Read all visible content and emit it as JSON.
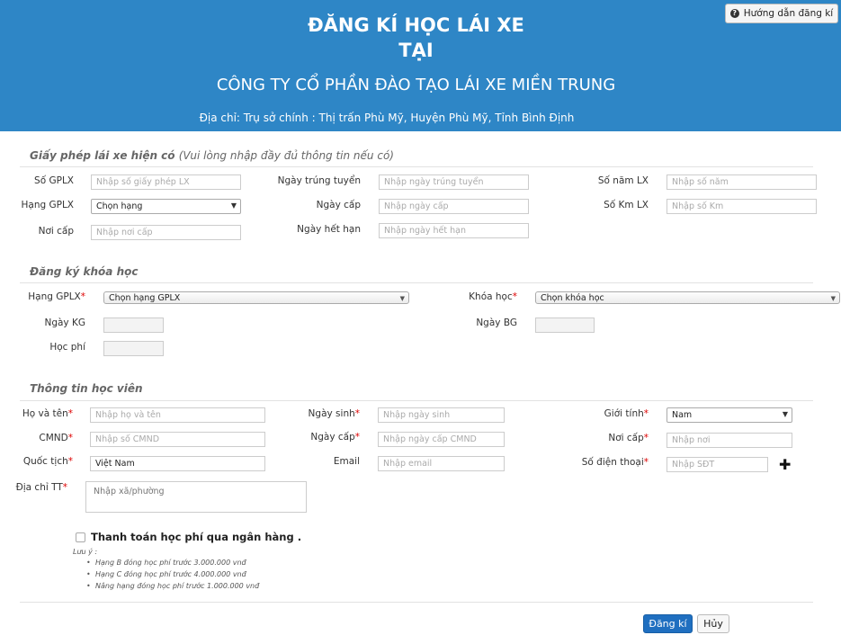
{
  "header": {
    "title_line1": "ĐĂNG KÍ HỌC LÁI XE",
    "title_line2": "TẠI",
    "company": "CÔNG TY CỔ PHẦN ĐÀO TẠO LÁI XE MIỀN TRUNG",
    "address": "Địa chỉ: Trụ sở chính : Thị trấn Phù Mỹ, Huyện Phù Mỹ, Tỉnh Bình Định",
    "help_button": "Hướng dẫn đăng kí"
  },
  "license": {
    "title": "Giấy phép lái xe hiện có",
    "note": "(Vui lòng nhập đầy đủ thông tin nếu có)",
    "so_gplx": {
      "label": "Số GPLX",
      "placeholder": "Nhập số giấy phép LX"
    },
    "hang_gplx": {
      "label": "Hạng GPLX",
      "value": "Chọn hạng"
    },
    "noi_cap": {
      "label": "Nơi cấp",
      "placeholder": "Nhập nơi cấp"
    },
    "ngay_trung_tuyen": {
      "label": "Ngày trúng tuyển",
      "placeholder": "Nhập ngày trúng tuyển"
    },
    "ngay_cap": {
      "label": "Ngày cấp",
      "placeholder": "Nhập ngày cấp"
    },
    "ngay_het_han": {
      "label": "Ngày hết hạn",
      "placeholder": "Nhập ngày hết hạn"
    },
    "so_nam_lx": {
      "label": "Số năm LX",
      "placeholder": "Nhập số năm"
    },
    "so_km_lx": {
      "label": "Số Km LX",
      "placeholder": "Nhập số Km"
    }
  },
  "course": {
    "title": "Đăng ký khóa học",
    "hang_gplx": {
      "label": "Hạng GPLX",
      "value": "Chọn hạng GPLX"
    },
    "khoa_hoc": {
      "label": "Khóa học",
      "value": "Chọn khóa học"
    },
    "ngay_kg": {
      "label": "Ngày KG"
    },
    "ngay_bg": {
      "label": "Ngày BG"
    },
    "hoc_phi": {
      "label": "Học phí"
    }
  },
  "student": {
    "title": "Thông tin học viên",
    "ho_ten": {
      "label": "Họ và tên",
      "placeholder": "Nhập họ và tên"
    },
    "cmnd": {
      "label": "CMND",
      "placeholder": "Nhập số CMND"
    },
    "quoc_tich": {
      "label": "Quốc tịch",
      "value": "Việt Nam"
    },
    "dia_chi": {
      "label": "Địa chỉ TT",
      "placeholder": "Nhập xã/phường"
    },
    "ngay_sinh": {
      "label": "Ngày sinh",
      "placeholder": "Nhập ngày sinh"
    },
    "ngay_cap": {
      "label": "Ngày cấp",
      "placeholder": "Nhập ngày cấp CMND"
    },
    "email": {
      "label": "Email",
      "placeholder": "Nhập email"
    },
    "gioi_tinh": {
      "label": "Giới tính",
      "value": "Nam"
    },
    "noi_cap": {
      "label": "Nơi cấp",
      "placeholder": "Nhập nơi"
    },
    "so_dien_thoai": {
      "label": "Số điện thoại",
      "placeholder": "Nhập SĐT"
    }
  },
  "payment": {
    "label": "Thanh toán học phí qua ngân hàng .",
    "note_title": "Lưu ý :",
    "notes": [
      "Hạng B đóng học phí trước 3.000.000 vnđ",
      "Hạng C đóng học phí trước 4.000.000 vnđ",
      "Nâng hạng đóng học phí trước 1.000.000 vnđ"
    ]
  },
  "actions": {
    "submit": "Đăng kí",
    "cancel": "Hủy"
  },
  "colors": {
    "header_bg": "#2e86c6",
    "primary_button": "#1f6fc0",
    "required_mark": "#d00000"
  }
}
